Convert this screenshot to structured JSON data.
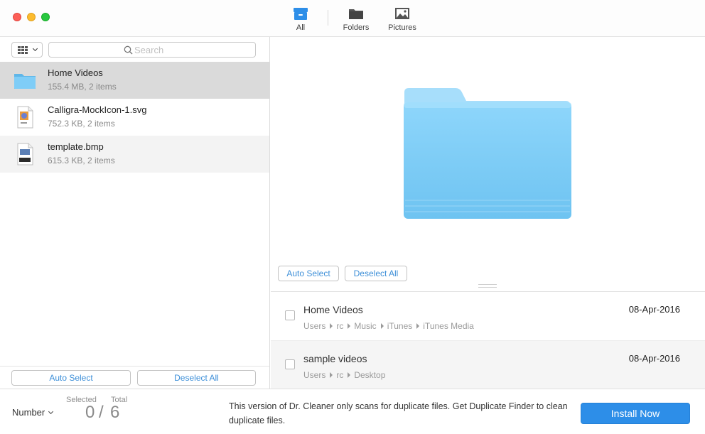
{
  "toolbar": {
    "tabs": [
      {
        "label": "All",
        "icon": "all-box-icon",
        "active": true
      },
      {
        "label": "Folders",
        "icon": "folder-icon",
        "active": false
      },
      {
        "label": "Pictures",
        "icon": "picture-icon",
        "active": false
      }
    ]
  },
  "left_pane": {
    "view_toggle_icon": "grid-view-icon",
    "search_placeholder": "Search",
    "files": [
      {
        "name": "Home Videos",
        "meta": "155.4 MB, 2 items",
        "icon": "folder-icon"
      },
      {
        "name": "Calligra-MockIcon-1.svg",
        "meta": "752.3 KB, 2 items",
        "icon": "svg-file-icon"
      },
      {
        "name": "template.bmp",
        "meta": "615.3 KB, 2 items",
        "icon": "bmp-file-icon"
      }
    ],
    "auto_select_label": "Auto Select",
    "deselect_all_label": "Deselect All"
  },
  "right_pane": {
    "preview_icon": "large-folder-icon",
    "auto_select_label": "Auto Select",
    "deselect_all_label": "Deselect All",
    "duplicates": [
      {
        "name": "Home Videos",
        "date": "08-Apr-2016",
        "path": [
          "Users",
          "rc",
          "Music",
          "iTunes",
          "iTunes Media"
        ],
        "checked": false
      },
      {
        "name": "sample videos",
        "date": "08-Apr-2016",
        "path": [
          "Users",
          "rc",
          "Desktop"
        ],
        "checked": false
      }
    ]
  },
  "bottom": {
    "sort_label": "Number",
    "selected_label": "Selected",
    "total_label": "Total",
    "selected_value": "0",
    "separator": "/",
    "total_value": "6",
    "notice": "This version of Dr. Cleaner only scans for duplicate files. Get Duplicate Finder to clean duplicate files.",
    "install_label": "Install Now"
  },
  "colors": {
    "accent": "#2d8ee8",
    "folder": "#7fcdf7",
    "selection": "#dadada"
  }
}
